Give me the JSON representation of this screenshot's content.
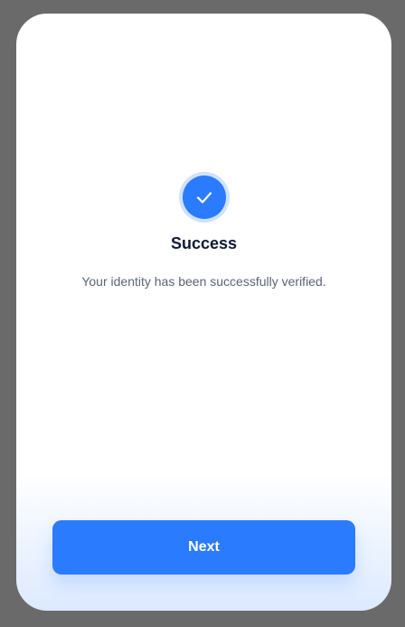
{
  "colors": {
    "background": "#6a6a6a",
    "card": "#ffffff",
    "accent": "#2b7bff",
    "title": "#0d1a33",
    "message": "#5a6377"
  },
  "icons": {
    "success": "check-circle-icon"
  },
  "success": {
    "title": "Success",
    "message": "Your identity has been successfully verified."
  },
  "actions": {
    "next_label": "Next"
  }
}
